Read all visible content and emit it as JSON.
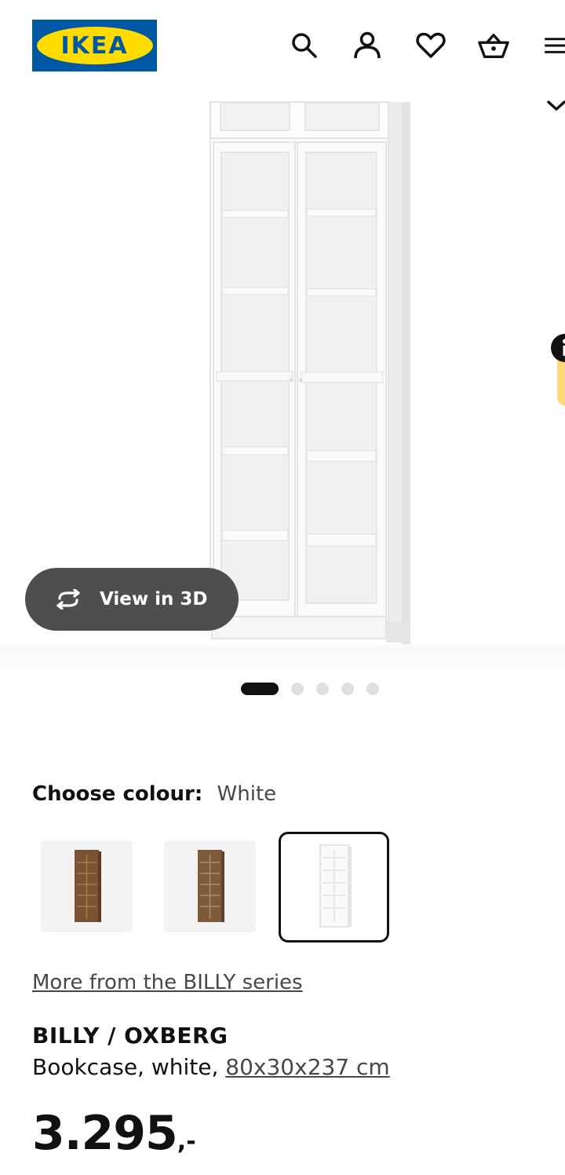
{
  "header": {
    "logo_text": "IKEA",
    "icons": [
      "search-icon",
      "user-icon",
      "heart-icon",
      "basket-icon",
      "menu-icon"
    ],
    "brand_blue": "#0058a3",
    "brand_yellow": "#ffdb00"
  },
  "gallery": {
    "view3d_label": "View in 3D",
    "view3d_icon": "rotate-3d-icon",
    "slides_total": 5,
    "slide_active": 1
  },
  "colour": {
    "label": "Choose colour:",
    "value": "White",
    "options": [
      "brown-finish",
      "brown-finish",
      "white"
    ]
  },
  "series_link": "More from the BILLY series",
  "product": {
    "name": "BILLY / OXBERG",
    "description": "Bookcase, white,",
    "size": "80x30x237 cm",
    "price": "3.295",
    "price_suffix": ",-"
  }
}
